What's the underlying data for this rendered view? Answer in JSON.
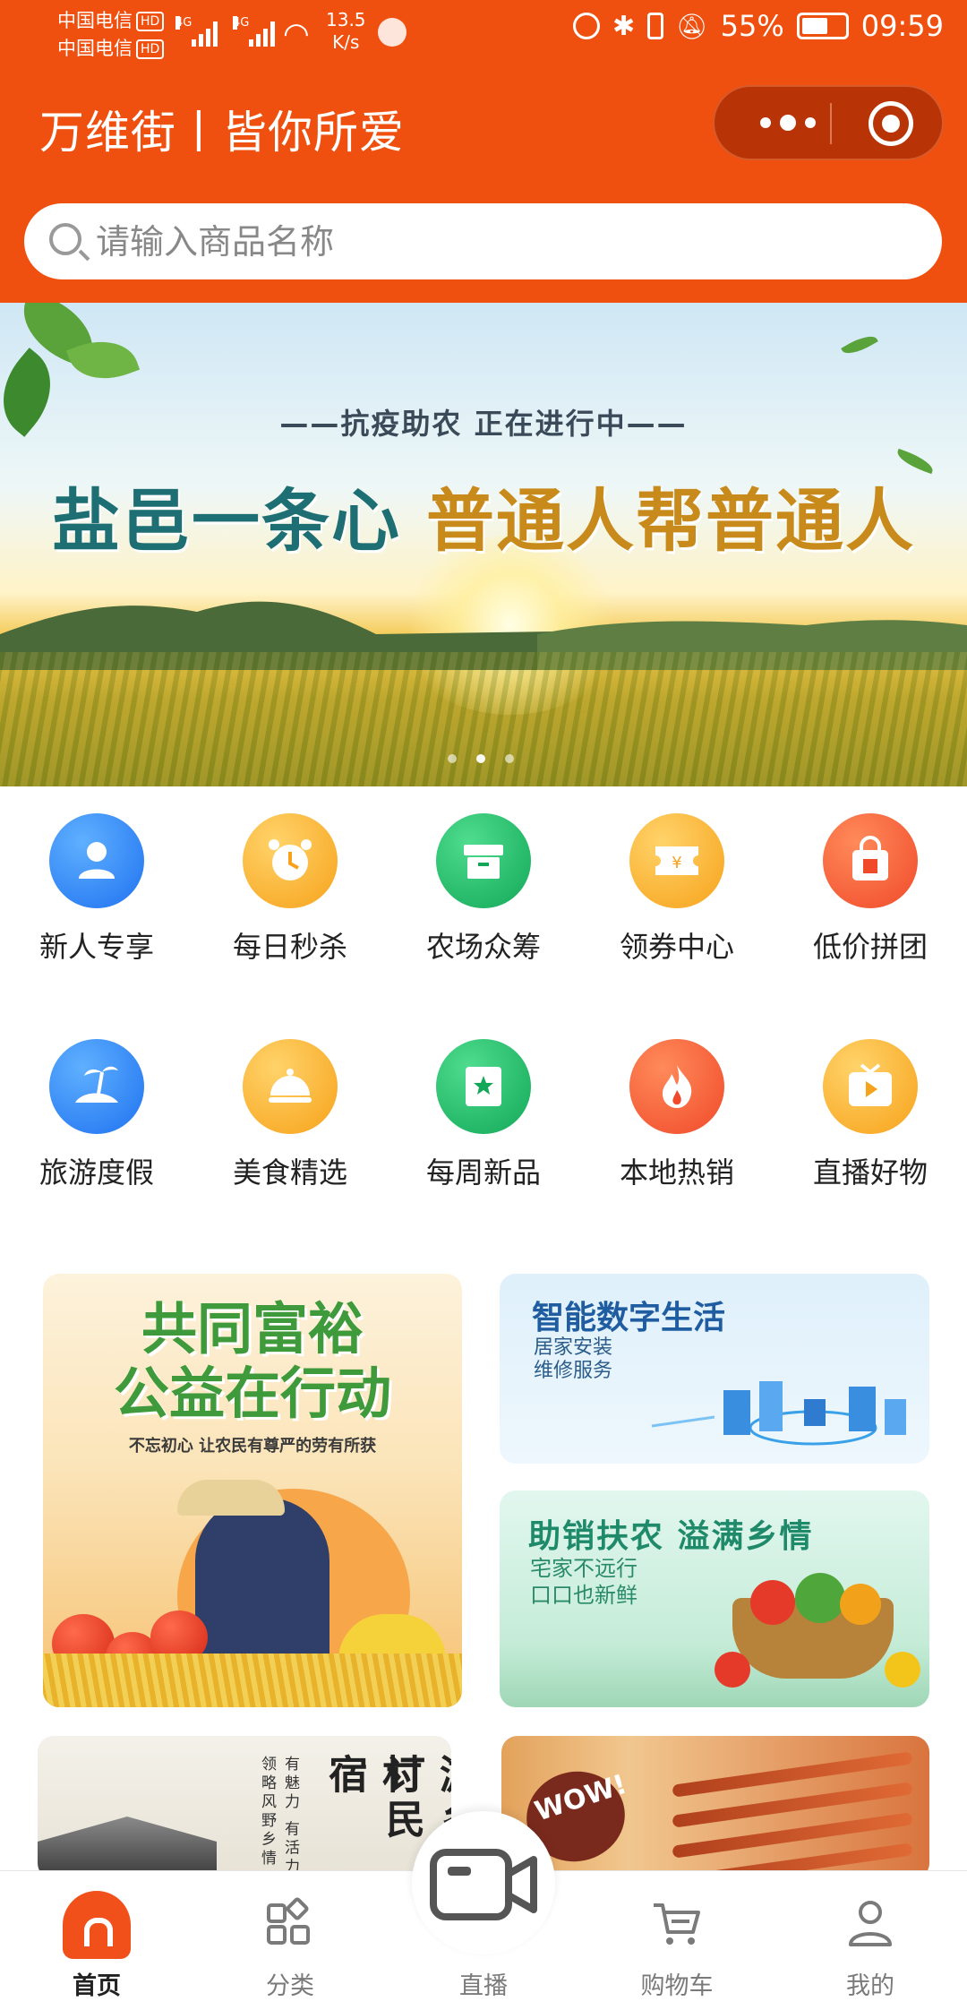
{
  "status_bar": {
    "carrier1": "中国电信",
    "carrier2": "中国电信",
    "hd": "HD",
    "net1": "4G",
    "net2": "4G",
    "speed_value": "13.5",
    "speed_unit": "K/s",
    "battery": "55%",
    "time": "09:59"
  },
  "header": {
    "title": "万维街丨皆你所爱",
    "menu_icon": "more-dots-icon",
    "close_icon": "target-circle-icon"
  },
  "search": {
    "placeholder": "请输入商品名称"
  },
  "banner": {
    "subtitle": "——抗疫助农  正在进行中——",
    "title_a": "盐邑一条心",
    "title_b": "普通人帮普通人",
    "dots": 3,
    "active_dot": 2
  },
  "categories": [
    {
      "label": "新人专享",
      "icon": "user-icon",
      "color": "blue"
    },
    {
      "label": "每日秒杀",
      "icon": "alarm-clock-icon",
      "color": "yellow"
    },
    {
      "label": "农场众筹",
      "icon": "box-icon",
      "color": "green"
    },
    {
      "label": "领券中心",
      "icon": "coupon-icon",
      "color": "yellow"
    },
    {
      "label": "低价拼团",
      "icon": "shopping-bag-icon",
      "color": "red"
    },
    {
      "label": "旅游度假",
      "icon": "island-icon",
      "color": "blue"
    },
    {
      "label": "美食精选",
      "icon": "dish-cloche-icon",
      "color": "yellow"
    },
    {
      "label": "每周新品",
      "icon": "bookmark-star-icon",
      "color": "green"
    },
    {
      "label": "本地热销",
      "icon": "fire-icon",
      "color": "red"
    },
    {
      "label": "直播好物",
      "icon": "tv-play-icon",
      "color": "yellow"
    }
  ],
  "promos": {
    "charity": {
      "title_line1": "共同富裕",
      "title_line2": "公益在行动",
      "subtitle": "不忘初心 让农民有尊严的劳有所获"
    },
    "digital": {
      "title": "智能数字生活",
      "sub_line1": "居家安装",
      "sub_line2": "维修服务"
    },
    "farm": {
      "title": "助销扶农  溢满乡情",
      "sub_line1": "宅家不远行",
      "sub_line2": "口口也新鲜"
    },
    "travel": {
      "col1": "游乡村",
      "col2": "订民宿",
      "small1": "有魅力 有活力",
      "small2": "领略风野乡情"
    },
    "bbq": {
      "badge": "WOW!"
    }
  },
  "tabbar": [
    {
      "label": "首页",
      "icon": "home-icon",
      "active": true
    },
    {
      "label": "分类",
      "icon": "category-grid-icon",
      "active": false
    },
    {
      "label": "直播",
      "icon": "video-camera-icon",
      "active": false
    },
    {
      "label": "购物车",
      "icon": "cart-icon",
      "active": false
    },
    {
      "label": "我的",
      "icon": "profile-icon",
      "active": false
    }
  ],
  "colors": {
    "brand": "#f0500f",
    "tab_active": "#f2501a"
  }
}
